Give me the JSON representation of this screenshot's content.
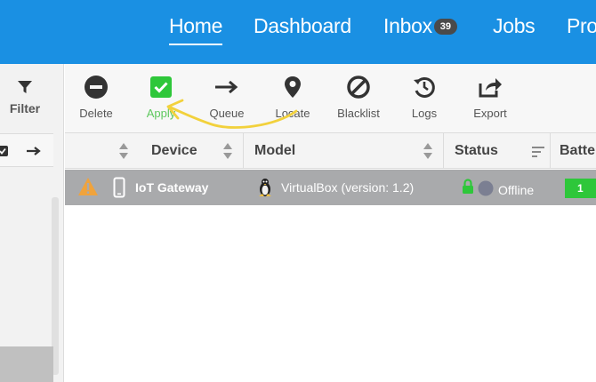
{
  "nav": {
    "items": [
      {
        "label": "Home",
        "active": true
      },
      {
        "label": "Dashboard"
      },
      {
        "label": "Inbox",
        "badge": "39"
      },
      {
        "label": "Jobs"
      },
      {
        "label": "Pro"
      }
    ]
  },
  "left_panel": {
    "filter_label": "Filter"
  },
  "toolbar": {
    "buttons": [
      {
        "label": "Delete",
        "icon": "minus-circle-icon"
      },
      {
        "label": "Apply",
        "icon": "check-square-icon"
      },
      {
        "label": "Queue",
        "icon": "arrow-right-icon"
      },
      {
        "label": "Locate",
        "icon": "map-pin-icon"
      },
      {
        "label": "Blacklist",
        "icon": "ban-icon"
      },
      {
        "label": "Logs",
        "icon": "history-icon"
      },
      {
        "label": "Export",
        "icon": "share-icon"
      }
    ]
  },
  "table": {
    "columns": [
      "Device",
      "Model",
      "Status",
      "Batte"
    ],
    "rows": [
      {
        "device": "IoT Gateway",
        "model": "VirtualBox (version: 1.2)",
        "status": "Offline",
        "battery": "1"
      }
    ]
  },
  "colors": {
    "nav_bg": "#1a90e3",
    "apply_green": "#2ec73a",
    "row_bg": "#a9aaac",
    "annotation": "#f2d13c"
  }
}
